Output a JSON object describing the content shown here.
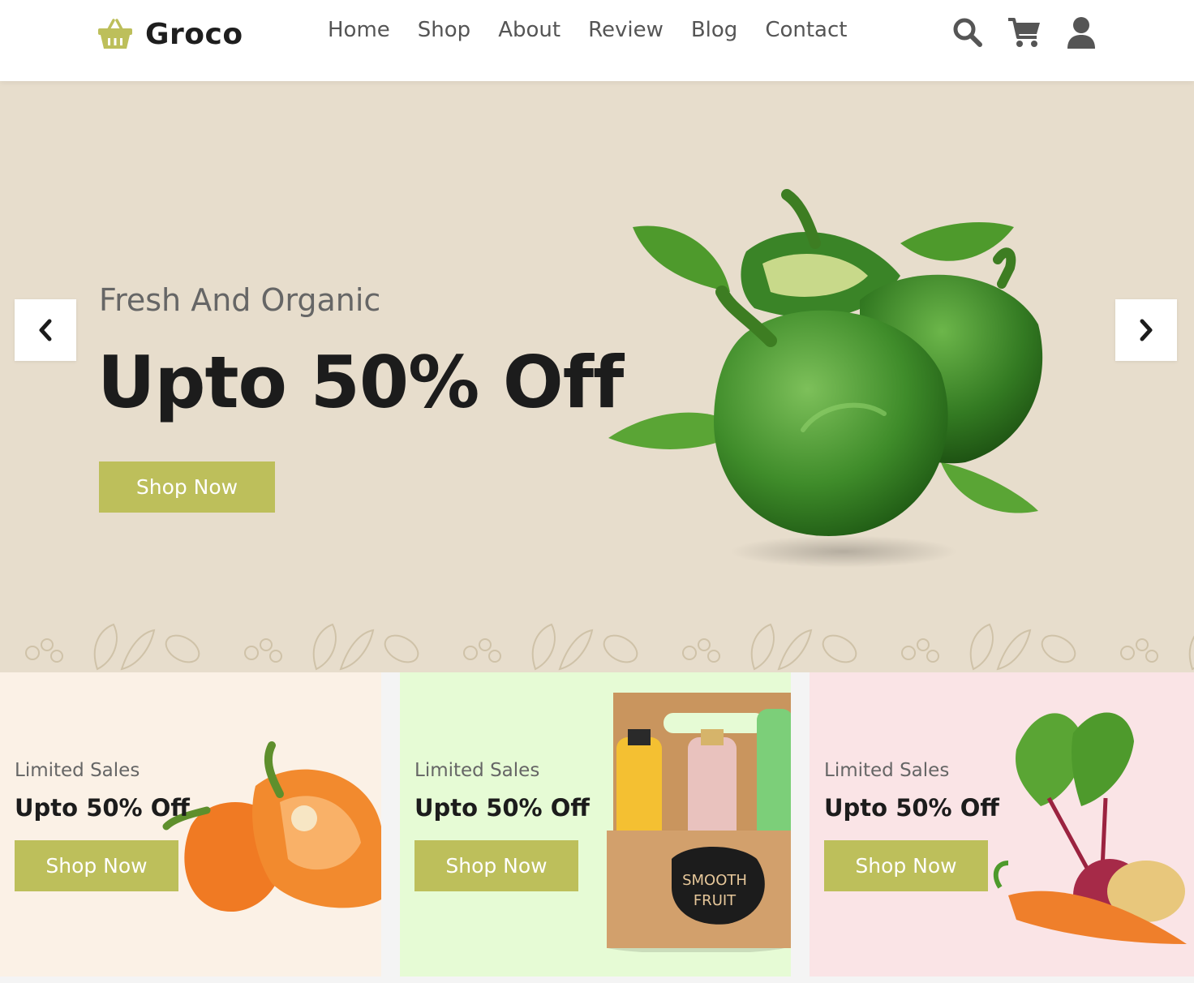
{
  "header": {
    "brand": "Groco",
    "nav": [
      "Home",
      "Shop",
      "About",
      "Review",
      "Blog",
      "Contact"
    ],
    "icons": [
      "search-icon",
      "cart-icon",
      "user-icon"
    ]
  },
  "hero": {
    "subtitle": "Fresh And Organic",
    "title": "Upto 50% Off",
    "button": "Shop Now"
  },
  "cards": [
    {
      "label": "Limited Sales",
      "title": "Upto 50% Off",
      "button": "Shop Now"
    },
    {
      "label": "Limited Sales",
      "title": "Upto 50% Off",
      "button": "Shop Now"
    },
    {
      "label": "Limited Sales",
      "title": "Upto 50% Off",
      "button": "Shop Now"
    }
  ],
  "colors": {
    "accent": "#bdbf5b",
    "hero_bg": "#e7ddcc",
    "card1_bg": "#fbf1e6",
    "card2_bg": "#e6fbd5",
    "card3_bg": "#fae4e6"
  }
}
